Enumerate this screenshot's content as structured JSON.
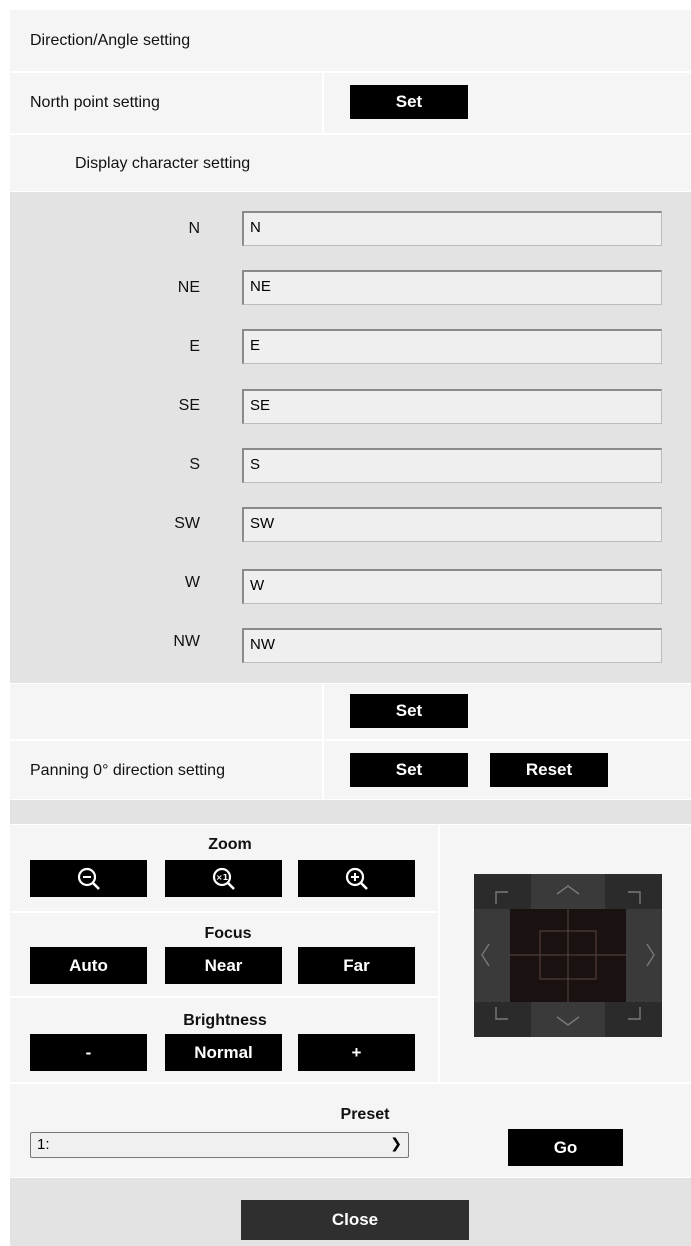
{
  "header": {
    "title": "Direction/Angle setting"
  },
  "north_point": {
    "label": "North point setting",
    "set_label": "Set"
  },
  "display_char": {
    "title": "Display character setting",
    "items": [
      {
        "label": "N",
        "value": "N"
      },
      {
        "label": "NE",
        "value": "NE"
      },
      {
        "label": "E",
        "value": "E"
      },
      {
        "label": "SE",
        "value": "SE"
      },
      {
        "label": "S",
        "value": "S"
      },
      {
        "label": "SW",
        "value": "SW"
      },
      {
        "label": "W",
        "value": "W"
      },
      {
        "label": "NW",
        "value": "NW"
      }
    ],
    "set_label": "Set"
  },
  "panning": {
    "label": "Panning 0° direction setting",
    "set_label": "Set",
    "reset_label": "Reset"
  },
  "zoom": {
    "title": "Zoom",
    "icons": [
      "zoom-out-icon",
      "zoom-reset-icon",
      "zoom-in-icon"
    ]
  },
  "focus": {
    "title": "Focus",
    "auto_label": "Auto",
    "near_label": "Near",
    "far_label": "Far"
  },
  "brightness": {
    "title": "Brightness",
    "minus_label": "-",
    "normal_label": "Normal",
    "plus_label": "+"
  },
  "preset": {
    "title": "Preset",
    "selected": "1:",
    "go_label": "Go"
  },
  "close_label": "Close",
  "colors": {
    "button": "#000000",
    "panel": "#e3e3e3",
    "row": "#f5f5f5",
    "pad": "#2a2a2a"
  }
}
